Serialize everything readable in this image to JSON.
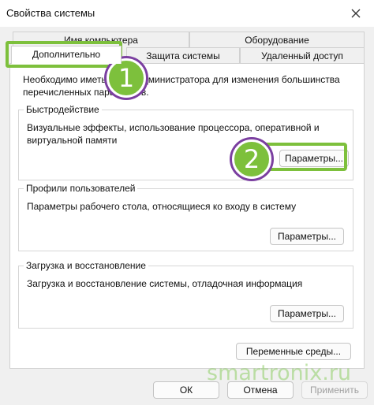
{
  "window": {
    "title": "Свойства системы"
  },
  "tabs_back": [
    "Имя компьютера",
    "Оборудование"
  ],
  "tabs_front": [
    "Дополнительно",
    "Защита системы",
    "Удаленный доступ"
  ],
  "intro_text_line1": "Необходимо иметь права администратора для изменения большинства",
  "intro_text_line2": "перечисленных параметров.",
  "performance": {
    "title": "Быстродействие",
    "desc_line1": "Визуальные эффекты, использование процессора, оперативной и",
    "desc_line2": "виртуальной памяти",
    "button": "Параметры..."
  },
  "profiles": {
    "title": "Профили пользователей",
    "desc": "Параметры рабочего стола, относящиеся ко входу в систему",
    "button": "Параметры..."
  },
  "startup": {
    "title": "Загрузка и восстановление",
    "desc": "Загрузка и восстановление системы, отладочная информация",
    "button": "Параметры..."
  },
  "env_button": "Переменные среды...",
  "dialog_buttons": {
    "ok": "ОК",
    "cancel": "Отмена",
    "apply": "Применить"
  },
  "badges": {
    "one": "1",
    "two": "2"
  },
  "watermark": "smartronix.ru",
  "colors": {
    "highlight": "#7dc03c",
    "badge_ring": "#7b3fa0"
  }
}
